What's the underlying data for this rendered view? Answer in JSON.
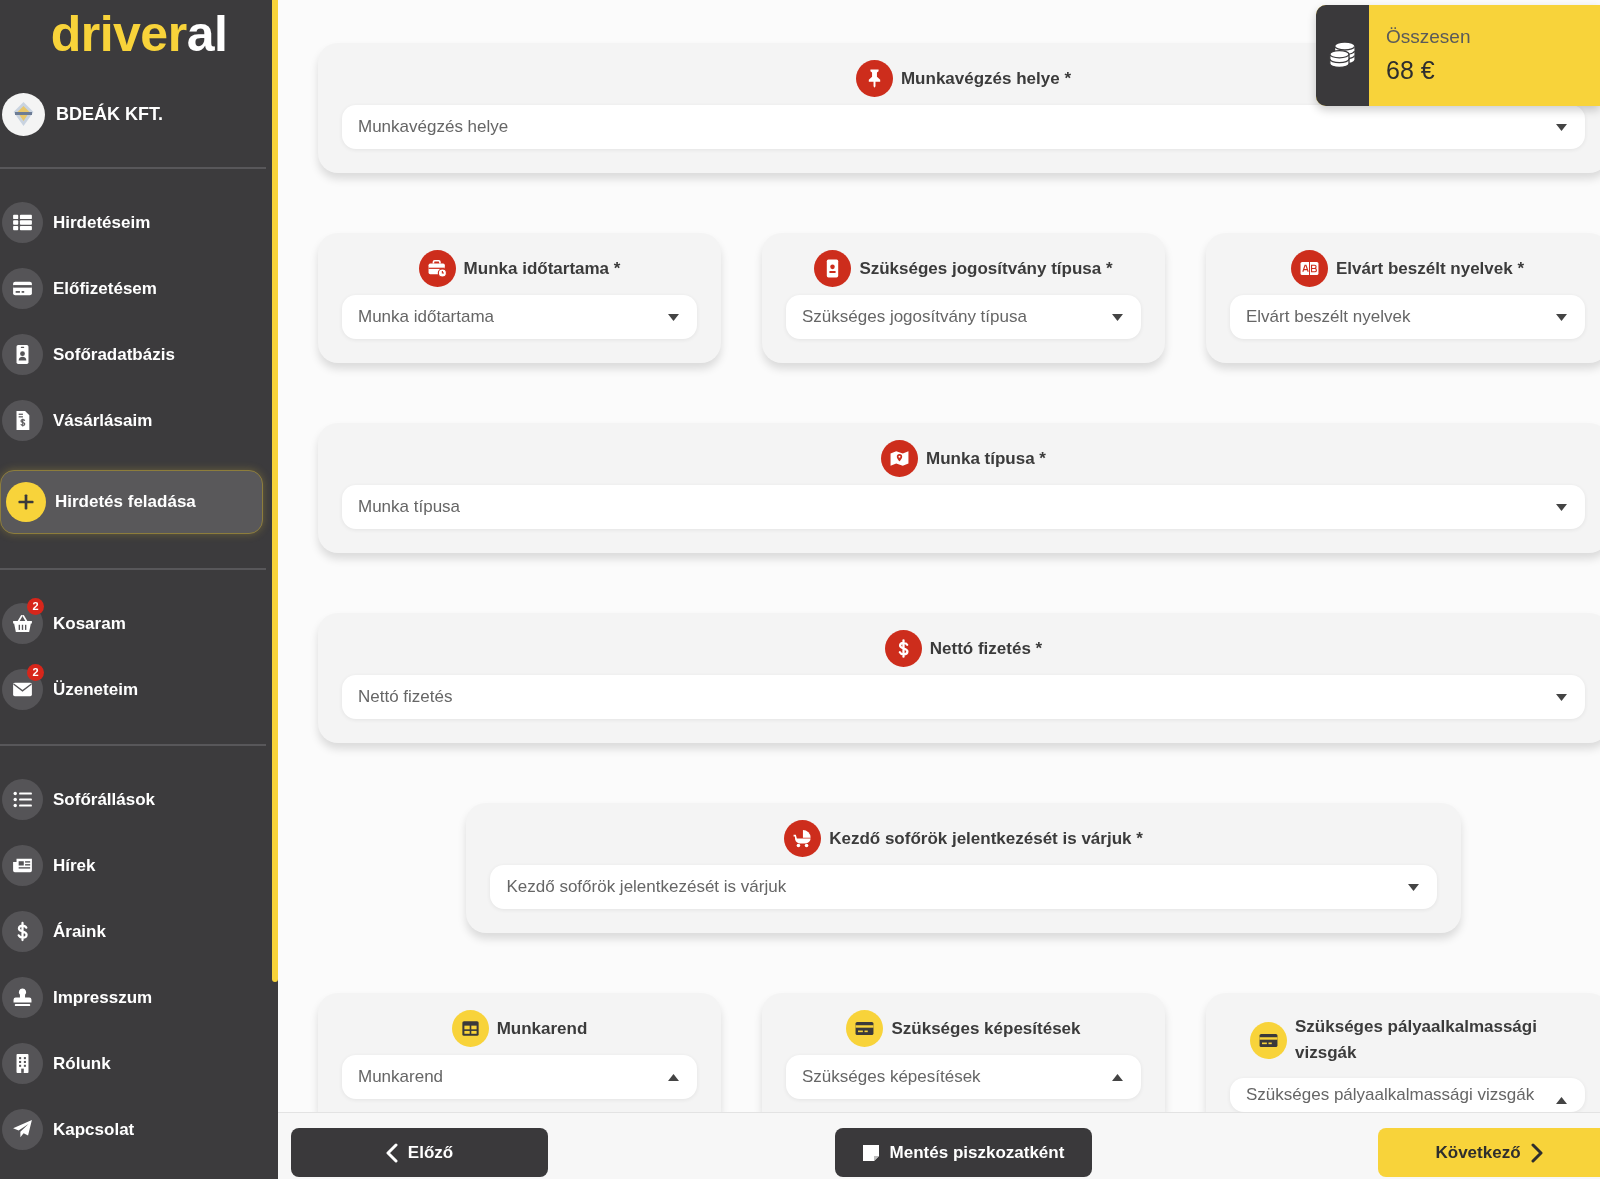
{
  "sidebar": {
    "logo": {
      "accent": "driver",
      "rest": "al"
    },
    "company": {
      "name": "BDEÁK KFT."
    },
    "sections": [
      {
        "items": [
          {
            "label": "Hirdetéseim",
            "kind": "link"
          },
          {
            "label": "Előfizetésem",
            "kind": "link"
          },
          {
            "label": "Sofőradatbázis",
            "kind": "link"
          },
          {
            "label": "Vásárlásaim",
            "kind": "link"
          },
          {
            "label": "Hirdetés feladása",
            "kind": "action"
          }
        ]
      },
      {
        "items": [
          {
            "label": "Kosaram",
            "kind": "link",
            "badge": "2"
          },
          {
            "label": "Üzeneteim",
            "kind": "link",
            "badge": "2"
          }
        ]
      },
      {
        "items": [
          {
            "label": "Sofőrállások",
            "kind": "link"
          },
          {
            "label": "Hírek",
            "kind": "link"
          },
          {
            "label": "Áraink",
            "kind": "link"
          },
          {
            "label": "Impresszum",
            "kind": "link"
          },
          {
            "label": "Rólunk",
            "kind": "link"
          },
          {
            "label": "Kapcsolat",
            "kind": "link"
          }
        ]
      }
    ]
  },
  "total": {
    "label": "Összesen",
    "amount": "68 €"
  },
  "form": {
    "rows": [
      {
        "kind": "full",
        "fields": [
          {
            "label": "Munkavégzés helye *",
            "placeholder": "Munkavégzés helye",
            "required": true,
            "kind": "dropdown"
          }
        ]
      },
      {
        "kind": "thirds",
        "fields": [
          {
            "label": "Munka időtartama *",
            "placeholder": "Munka időtartama",
            "required": true,
            "kind": "dropdown"
          },
          {
            "label": "Szükséges jogosítvány típusa *",
            "placeholder": "Szükséges jogosítvány típusa",
            "required": true,
            "kind": "dropdown"
          },
          {
            "label": "Elvárt beszélt nyelvek *",
            "placeholder": "Elvárt beszélt nyelvek",
            "required": true,
            "kind": "dropdown"
          }
        ]
      },
      {
        "kind": "full",
        "fields": [
          {
            "label": "Munka típusa *",
            "placeholder": "Munka típusa",
            "required": true,
            "kind": "dropdown"
          }
        ]
      },
      {
        "kind": "full",
        "fields": [
          {
            "label": "Nettó fizetés *",
            "placeholder": "Nettó fizetés",
            "required": true,
            "kind": "dropdown"
          }
        ]
      },
      {
        "kind": "narrow",
        "fields": [
          {
            "label": "Kezdő sofőrök jelentkezését is várjuk *",
            "placeholder": "Kezdő sofőrök jelentkezését is várjuk",
            "required": true,
            "kind": "dropdown"
          }
        ]
      },
      {
        "kind": "thirds",
        "fields": [
          {
            "label": "Munkarend",
            "placeholder": "Munkarend",
            "required": false,
            "kind": "dropup"
          },
          {
            "label": "Szükséges képesítések",
            "placeholder": "Szükséges képesítések",
            "required": false,
            "kind": "dropup"
          },
          {
            "label": "Szükséges pályaalkalmassági vizsgák",
            "placeholder": "Szükséges pályaalkalmassági vizsgák",
            "required": false,
            "kind": "dropup"
          }
        ]
      }
    ]
  },
  "footer": {
    "buttons": [
      {
        "label": "Előző",
        "kind": "back"
      },
      {
        "label": "Mentés piszkozatként",
        "kind": "draft"
      },
      {
        "label": "Következő",
        "kind": "next"
      }
    ]
  }
}
